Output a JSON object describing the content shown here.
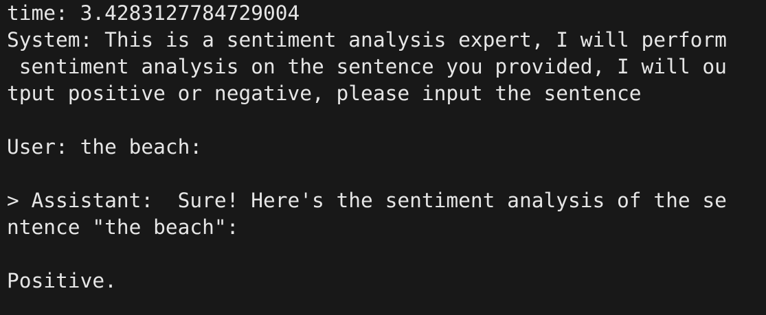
{
  "terminal": {
    "lines": [
      "time: 3.4283127784729004",
      "System: This is a sentiment analysis expert, I will perform",
      " sentiment analysis on the sentence you provided, I will ou",
      "tput positive or negative, please input the sentence",
      "",
      "User: the beach:",
      "",
      "> Assistant:  Sure! Here's the sentiment analysis of the se",
      "ntence \"the beach\":",
      "",
      "Positive."
    ]
  },
  "colors": {
    "background": "#181818",
    "text": "#e6e6e6"
  }
}
